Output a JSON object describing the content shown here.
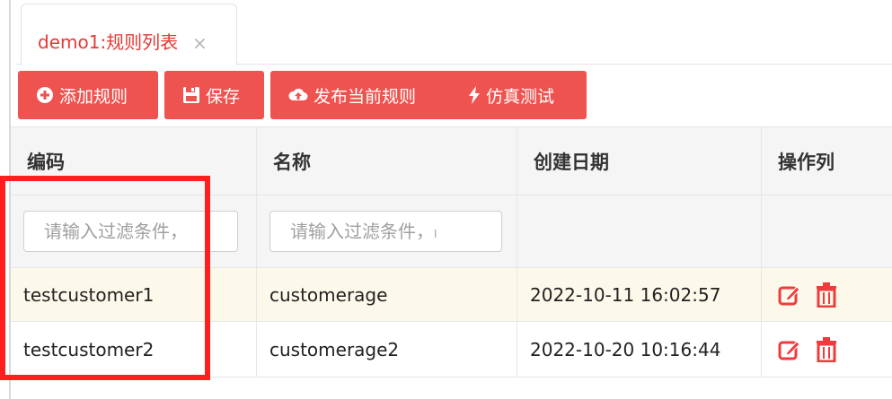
{
  "tab": {
    "label": "demo1:规则列表",
    "close": "×"
  },
  "toolbar": {
    "add_label": "添加规则",
    "save_label": "保存",
    "publish_label": "发布当前规则",
    "simulate_label": "仿真测试"
  },
  "table": {
    "columns": [
      "编码",
      "名称",
      "创建日期",
      "操作列"
    ],
    "filter_placeholder_code": "请输入过滤条件，",
    "filter_placeholder_name": "请输入过滤条件，ₗ",
    "rows": [
      {
        "code": "testcustomer1",
        "name": "customerage",
        "created": "2022-10-11 16:02:57"
      },
      {
        "code": "testcustomer2",
        "name": "customerage2",
        "created": "2022-10-20 10:16:44"
      }
    ]
  },
  "colors": {
    "accent": "#ef5350",
    "highlight": "#ff1f1f",
    "tab_text": "#e53935"
  },
  "icons": [
    "plus-circle-icon",
    "floppy-disk-icon",
    "cloud-upload-icon",
    "lightning-icon",
    "edit-icon",
    "trash-icon",
    "close-icon"
  ]
}
